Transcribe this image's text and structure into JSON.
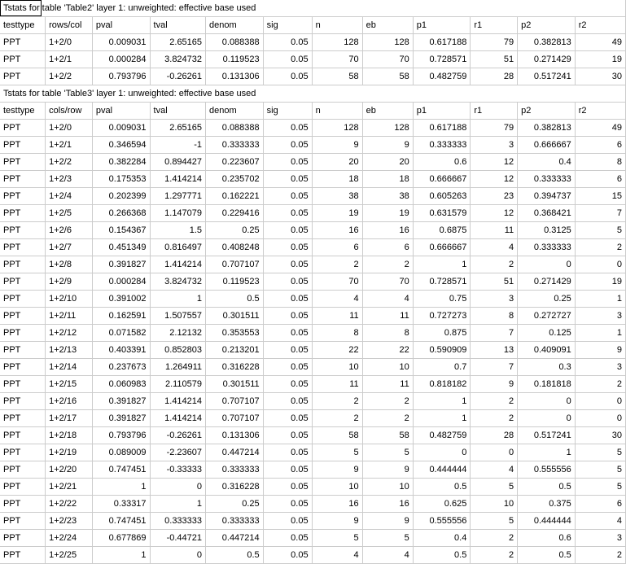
{
  "sections": [
    {
      "title": "Tstats for table 'Table2' layer 1: unweighted: effective base used",
      "outlined_first_cell": true,
      "col2_header": "rows/col",
      "headers": [
        "testtype",
        "rows/col",
        "pval",
        "tval",
        "denom",
        "sig",
        "n",
        "eb",
        "p1",
        "r1",
        "p2",
        "r2"
      ],
      "rows": [
        [
          "PPT",
          "1+2/0",
          "0.009031",
          "2.65165",
          "0.088388",
          "0.05",
          "128",
          "128",
          "0.617188",
          "79",
          "0.382813",
          "49"
        ],
        [
          "PPT",
          "1+2/1",
          "0.000284",
          "3.824732",
          "0.119523",
          "0.05",
          "70",
          "70",
          "0.728571",
          "51",
          "0.271429",
          "19"
        ],
        [
          "PPT",
          "1+2/2",
          "0.793796",
          "-0.26261",
          "0.131306",
          "0.05",
          "58",
          "58",
          "0.482759",
          "28",
          "0.517241",
          "30"
        ]
      ]
    },
    {
      "title": "Tstats for table 'Table3' layer 1: unweighted: effective base used",
      "outlined_first_cell": false,
      "col2_header": "cols/row",
      "headers": [
        "testtype",
        "cols/row",
        "pval",
        "tval",
        "denom",
        "sig",
        "n",
        "eb",
        "p1",
        "r1",
        "p2",
        "r2"
      ],
      "rows": [
        [
          "PPT",
          "1+2/0",
          "0.009031",
          "2.65165",
          "0.088388",
          "0.05",
          "128",
          "128",
          "0.617188",
          "79",
          "0.382813",
          "49"
        ],
        [
          "PPT",
          "1+2/1",
          "0.346594",
          "-1",
          "0.333333",
          "0.05",
          "9",
          "9",
          "0.333333",
          "3",
          "0.666667",
          "6"
        ],
        [
          "PPT",
          "1+2/2",
          "0.382284",
          "0.894427",
          "0.223607",
          "0.05",
          "20",
          "20",
          "0.6",
          "12",
          "0.4",
          "8"
        ],
        [
          "PPT",
          "1+2/3",
          "0.175353",
          "1.414214",
          "0.235702",
          "0.05",
          "18",
          "18",
          "0.666667",
          "12",
          "0.333333",
          "6"
        ],
        [
          "PPT",
          "1+2/4",
          "0.202399",
          "1.297771",
          "0.162221",
          "0.05",
          "38",
          "38",
          "0.605263",
          "23",
          "0.394737",
          "15"
        ],
        [
          "PPT",
          "1+2/5",
          "0.266368",
          "1.147079",
          "0.229416",
          "0.05",
          "19",
          "19",
          "0.631579",
          "12",
          "0.368421",
          "7"
        ],
        [
          "PPT",
          "1+2/6",
          "0.154367",
          "1.5",
          "0.25",
          "0.05",
          "16",
          "16",
          "0.6875",
          "11",
          "0.3125",
          "5"
        ],
        [
          "PPT",
          "1+2/7",
          "0.451349",
          "0.816497",
          "0.408248",
          "0.05",
          "6",
          "6",
          "0.666667",
          "4",
          "0.333333",
          "2"
        ],
        [
          "PPT",
          "1+2/8",
          "0.391827",
          "1.414214",
          "0.707107",
          "0.05",
          "2",
          "2",
          "1",
          "2",
          "0",
          "0"
        ],
        [
          "PPT",
          "1+2/9",
          "0.000284",
          "3.824732",
          "0.119523",
          "0.05",
          "70",
          "70",
          "0.728571",
          "51",
          "0.271429",
          "19"
        ],
        [
          "PPT",
          "1+2/10",
          "0.391002",
          "1",
          "0.5",
          "0.05",
          "4",
          "4",
          "0.75",
          "3",
          "0.25",
          "1"
        ],
        [
          "PPT",
          "1+2/11",
          "0.162591",
          "1.507557",
          "0.301511",
          "0.05",
          "11",
          "11",
          "0.727273",
          "8",
          "0.272727",
          "3"
        ],
        [
          "PPT",
          "1+2/12",
          "0.071582",
          "2.12132",
          "0.353553",
          "0.05",
          "8",
          "8",
          "0.875",
          "7",
          "0.125",
          "1"
        ],
        [
          "PPT",
          "1+2/13",
          "0.403391",
          "0.852803",
          "0.213201",
          "0.05",
          "22",
          "22",
          "0.590909",
          "13",
          "0.409091",
          "9"
        ],
        [
          "PPT",
          "1+2/14",
          "0.237673",
          "1.264911",
          "0.316228",
          "0.05",
          "10",
          "10",
          "0.7",
          "7",
          "0.3",
          "3"
        ],
        [
          "PPT",
          "1+2/15",
          "0.060983",
          "2.110579",
          "0.301511",
          "0.05",
          "11",
          "11",
          "0.818182",
          "9",
          "0.181818",
          "2"
        ],
        [
          "PPT",
          "1+2/16",
          "0.391827",
          "1.414214",
          "0.707107",
          "0.05",
          "2",
          "2",
          "1",
          "2",
          "0",
          "0"
        ],
        [
          "PPT",
          "1+2/17",
          "0.391827",
          "1.414214",
          "0.707107",
          "0.05",
          "2",
          "2",
          "1",
          "2",
          "0",
          "0"
        ],
        [
          "PPT",
          "1+2/18",
          "0.793796",
          "-0.26261",
          "0.131306",
          "0.05",
          "58",
          "58",
          "0.482759",
          "28",
          "0.517241",
          "30"
        ],
        [
          "PPT",
          "1+2/19",
          "0.089009",
          "-2.23607",
          "0.447214",
          "0.05",
          "5",
          "5",
          "0",
          "0",
          "1",
          "5"
        ],
        [
          "PPT",
          "1+2/20",
          "0.747451",
          "-0.33333",
          "0.333333",
          "0.05",
          "9",
          "9",
          "0.444444",
          "4",
          "0.555556",
          "5"
        ],
        [
          "PPT",
          "1+2/21",
          "1",
          "0",
          "0.316228",
          "0.05",
          "10",
          "10",
          "0.5",
          "5",
          "0.5",
          "5"
        ],
        [
          "PPT",
          "1+2/22",
          "0.33317",
          "1",
          "0.25",
          "0.05",
          "16",
          "16",
          "0.625",
          "10",
          "0.375",
          "6"
        ],
        [
          "PPT",
          "1+2/23",
          "0.747451",
          "0.333333",
          "0.333333",
          "0.05",
          "9",
          "9",
          "0.555556",
          "5",
          "0.444444",
          "4"
        ],
        [
          "PPT",
          "1+2/24",
          "0.677869",
          "-0.44721",
          "0.447214",
          "0.05",
          "5",
          "5",
          "0.4",
          "2",
          "0.6",
          "3"
        ],
        [
          "PPT",
          "1+2/25",
          "1",
          "0",
          "0.5",
          "0.05",
          "4",
          "4",
          "0.5",
          "2",
          "0.5",
          "2"
        ]
      ]
    }
  ]
}
